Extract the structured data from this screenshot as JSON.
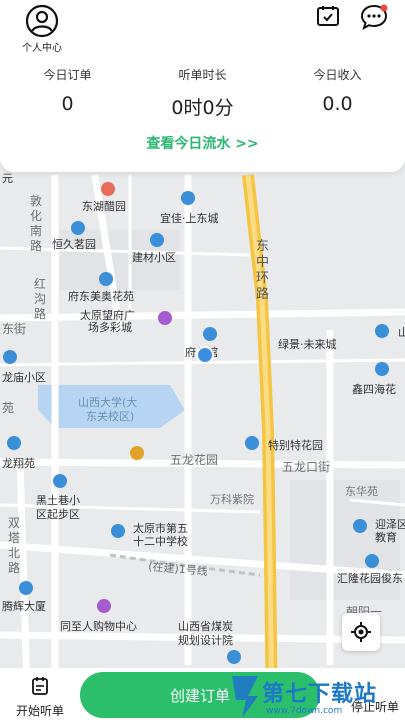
{
  "header": {
    "profile_label": "个人中心",
    "stats": [
      {
        "label": "今日订单",
        "value": "0"
      },
      {
        "label": "听单时长",
        "value": "0时0分"
      },
      {
        "label": "今日收入",
        "value": "0.0"
      }
    ],
    "flow_link": "查看今日流水 >>"
  },
  "map": {
    "road_labels": [
      "敦化南路",
      "红沟路",
      "东街",
      "双塔北路",
      "东中环路",
      "五龙花园",
      "五龙口街",
      "(在建)1号线",
      "朝阳一"
    ],
    "poi_labels": [
      "东湖醋园",
      "宜佳·上东城",
      "恒久茗园",
      "建材小区",
      "府东美奥花苑",
      "太原望府广场多彩城",
      "府公馆",
      "绿景·未来城",
      "鑫四海花",
      "龙庙小区",
      "山西大学(大东关校区)",
      "特别特花园",
      "龙翔苑",
      "万科紫院",
      "东华苑",
      "黑土巷小区起步区",
      "太原市第五十二中学校",
      "迎泽区教育",
      "汇隆花园俊东",
      "腾辉大厦",
      "同至人购物中心",
      "山西省煤炭规划设计院",
      "元",
      "山",
      "苑"
    ]
  },
  "bottom": {
    "start_label": "开始听单",
    "create_label": "创建订单",
    "stop_label": "停止听单"
  },
  "watermark": {
    "text": "第七下载站",
    "url": "www.7down.com"
  },
  "colors": {
    "accent": "#2bbf6c",
    "highway": "#f4c542",
    "map_bg": "#e9eaec",
    "water": "#b7d5f2",
    "poi_blue": "#3a8fd8"
  }
}
